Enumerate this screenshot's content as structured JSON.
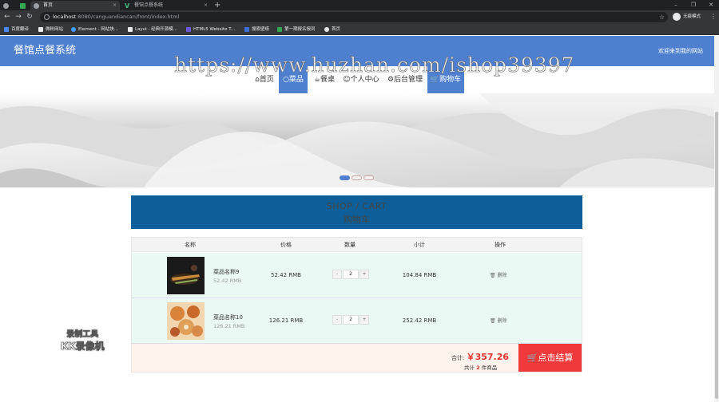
{
  "browser": {
    "tabs": [
      {
        "label": ""
      },
      {
        "label": "首页",
        "active": true
      },
      {
        "label": "餐馆点餐系统"
      }
    ],
    "address": {
      "host": "localhost",
      "path": ":8080/canguandiancan/front/index.html"
    },
    "profile_label": "无痕模式",
    "bookmarks": [
      "百度翻译",
      "微粉网站",
      "Element - 网站快...",
      "Layui - 经典开源模...",
      "HTML5 Website T...",
      "搜索壁纸",
      "第一期报名报到",
      "首页"
    ]
  },
  "site": {
    "title": "餐馆点餐系统",
    "welcome": "欢迎来到我的网站",
    "nav": [
      {
        "label": "⌂首页"
      },
      {
        "label": "○菜品",
        "active": true
      },
      {
        "label": "☕餐桌"
      },
      {
        "label": "☺个人中心"
      },
      {
        "label": "⚙后台管理"
      },
      {
        "label": "🛒购物车",
        "highlight": true
      }
    ],
    "watermark": "https://www.huzhan.com/ishop39397",
    "carousel": {
      "slides": 3,
      "active_index": 0
    }
  },
  "cart": {
    "title_en": "SHOP / CART",
    "title_cn": "购物车",
    "headers": [
      "名称",
      "价格",
      "数量",
      "小计",
      "操作"
    ],
    "items": [
      {
        "name": "菜品名称9",
        "unit_price_sub": "52.42 RMB",
        "price": "52.42 RMB",
        "qty": "2",
        "subtotal": "104.84 RMB",
        "action": "删除",
        "img": "dark"
      },
      {
        "name": "菜品名称10",
        "unit_price_sub": "126.21 RMB",
        "price": "126.21 RMB",
        "qty": "2",
        "subtotal": "252.42 RMB",
        "action": "删除",
        "img": "warm"
      }
    ],
    "total_label": "合计:",
    "total_value": "￥357.26",
    "count_prefix": "共计",
    "count_value": "2",
    "count_suffix": "件商品",
    "checkout_label": "🛒点击结算",
    "minus": "-",
    "plus": "+"
  },
  "overlay": {
    "line1": "录制工具",
    "line2": "KK录像机"
  },
  "colors": {
    "primary": "#4f80cf",
    "cart_banner": "#0e5f99",
    "checkout": "#f0393a",
    "row_bg": "#eaf9f4",
    "price": "#e0322e"
  }
}
